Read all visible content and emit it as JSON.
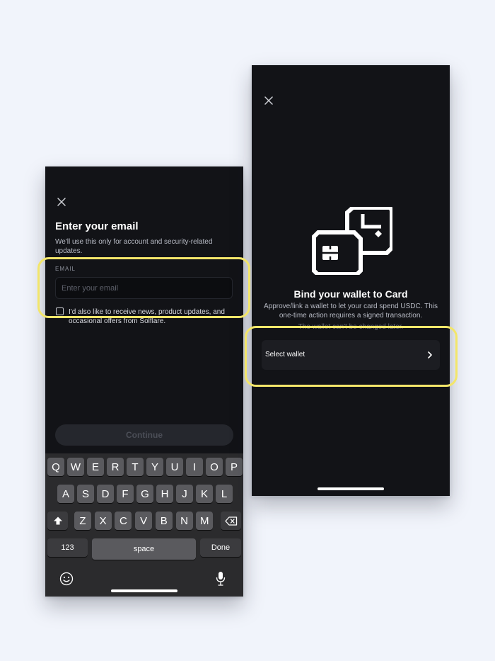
{
  "email_screen": {
    "title": "Enter your email",
    "subtitle": "We'll use this only for account and security-related updates.",
    "email_label": "EMAIL",
    "email_placeholder": "Enter your email",
    "email_value": "",
    "newsletter_text": "I'd also like to receive news, product updates, and occasional offers from Solflare.",
    "newsletter_checked": false,
    "continue_label": "Continue"
  },
  "keyboard": {
    "row1": [
      "Q",
      "W",
      "E",
      "R",
      "T",
      "Y",
      "U",
      "I",
      "O",
      "P"
    ],
    "row2": [
      "A",
      "S",
      "D",
      "F",
      "G",
      "H",
      "J",
      "K",
      "L"
    ],
    "row3": [
      "Z",
      "X",
      "C",
      "V",
      "B",
      "N",
      "M"
    ],
    "numbers_label": "123",
    "space_label": "space",
    "done_label": "Done",
    "icons": [
      "shift-icon",
      "backspace-icon",
      "emoji-icon",
      "microphone-icon"
    ]
  },
  "wallet_screen": {
    "title": "Bind your wallet to Card",
    "subtitle": "Approve/link a wallet to let your card spend USDC. This one-time action requires a signed transaction.",
    "faded_note": "The wallet can't be changed later.",
    "select_wallet_label": "Select wallet",
    "illustration_icon": "wallet-card-icon"
  },
  "colors": {
    "background": "#f1f4fb",
    "phone_bg": "#121317",
    "highlight": "#f3e66a"
  }
}
